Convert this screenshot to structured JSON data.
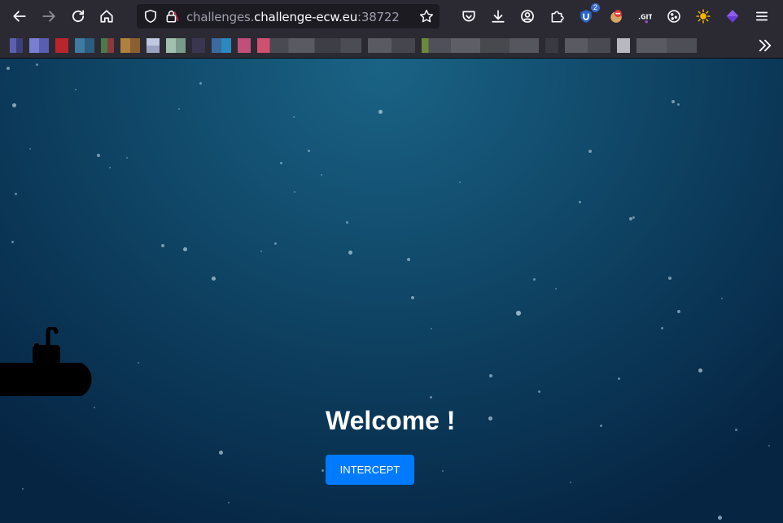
{
  "browser": {
    "url_subdomain": "challenges.",
    "url_domain": "challenge-ecw.eu",
    "url_port": ":38722",
    "extension_badge": "2"
  },
  "page": {
    "heading": "Welcome !",
    "button_label": "INTERCEPT"
  },
  "colors": {
    "toolbar": "#2b2a33",
    "urlbar": "#1c1b22",
    "page_bg_center": "#1a6385",
    "page_bg_edge": "#062543",
    "button": "#007bff"
  }
}
